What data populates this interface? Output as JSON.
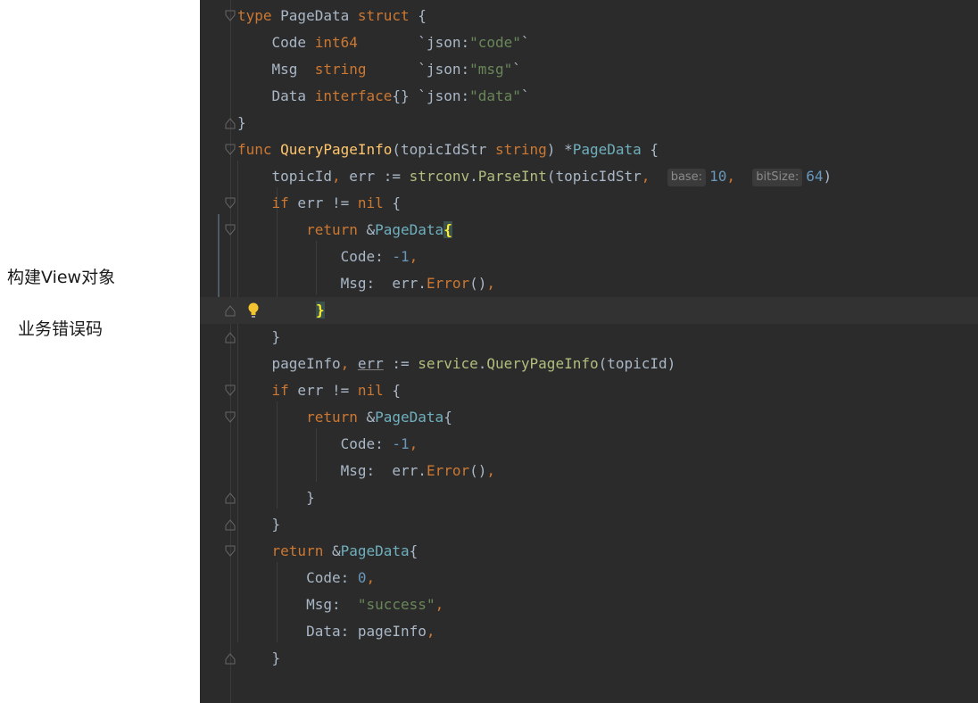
{
  "annotations": {
    "left_1": "构建View对象",
    "left_2": "业务错误码"
  },
  "code": {
    "l1": {
      "t1": "type",
      "t2": " PageData ",
      "t3": "struct",
      "t4": " {"
    },
    "l2": {
      "t1": "    Code ",
      "t2": "int64",
      "t3": "       `json:",
      "t4": "\"code\"",
      "t5": "`"
    },
    "l3": {
      "t1": "    Msg  ",
      "t2": "string",
      "t3": "      `json:",
      "t4": "\"msg\"",
      "t5": "`"
    },
    "l4": {
      "t1": "    Data ",
      "t2": "interface",
      "t3": "{} `json:",
      "t4": "\"data\"",
      "t5": "`"
    },
    "l5": {
      "t1": "}"
    },
    "l6": {
      "t1": "func ",
      "t2": "QueryPageInfo",
      "t3": "(topicIdStr ",
      "t4": "string",
      "t5": ") *",
      "t6": "PageData",
      "t7": " {"
    },
    "l7": {
      "t1": "    topicId",
      "t2": ", ",
      "t3": "err := ",
      "t4": "strconv",
      "t5": ".",
      "t6": "ParseInt",
      "t7": "(topicIdStr",
      "t8": ",  ",
      "hint1": "base:",
      "t9": "10",
      "t10": ",  ",
      "hint2": "bitSize:",
      "t11": "64",
      "t12": ")"
    },
    "l8": {
      "t1": "    if",
      "t2": " err != ",
      "t3": "nil",
      "t4": " {"
    },
    "l9": {
      "t1": "        return",
      "t2": " &",
      "t3": "PageData",
      "t4": "{"
    },
    "l10": {
      "t1": "            Code",
      "t2": ": ",
      "t3": "-1",
      "t4": ","
    },
    "l11": {
      "t1": "            Msg",
      "t2": ":  err.",
      "t3": "Error",
      "t4": "()",
      "t5": ","
    },
    "l12": {
      "t1": "}"
    },
    "l13": {
      "t1": "    }"
    },
    "l14": {
      "t1": "    pageInfo",
      "t2": ", ",
      "t3": "err",
      "t4": " := ",
      "t5": "service",
      "t6": ".",
      "t7": "QueryPageInfo",
      "t8": "(topicId)"
    },
    "l15": {
      "t1": "    if",
      "t2": " err != ",
      "t3": "nil",
      "t4": " {"
    },
    "l16": {
      "t1": "        return",
      "t2": " &",
      "t3": "PageData",
      "t4": "{"
    },
    "l17": {
      "t1": "            Code",
      "t2": ": ",
      "t3": "-1",
      "t4": ","
    },
    "l18": {
      "t1": "            Msg",
      "t2": ":  err.",
      "t3": "Error",
      "t4": "()",
      "t5": ","
    },
    "l19": {
      "t1": "        }"
    },
    "l20": {
      "t1": "    }"
    },
    "l21": {
      "t1": "    return",
      "t2": " &",
      "t3": "PageData",
      "t4": "{"
    },
    "l22": {
      "t1": "        Code",
      "t2": ": ",
      "t3": "0",
      "t4": ","
    },
    "l23": {
      "t1": "        Msg",
      "t2": ":  ",
      "t3": "\"success\"",
      "t4": ","
    },
    "l24": {
      "t1": "        Data",
      "t2": ": pageInfo",
      "t3": ","
    },
    "l25": {
      "t1": "    }"
    }
  },
  "colors": {
    "background": "#2b2b2b",
    "keyword": "#cc7832",
    "function": "#ffc66d",
    "type": "#6fafbd",
    "number": "#6897bb",
    "string": "#6a8759",
    "text": "#a9b7c6"
  }
}
